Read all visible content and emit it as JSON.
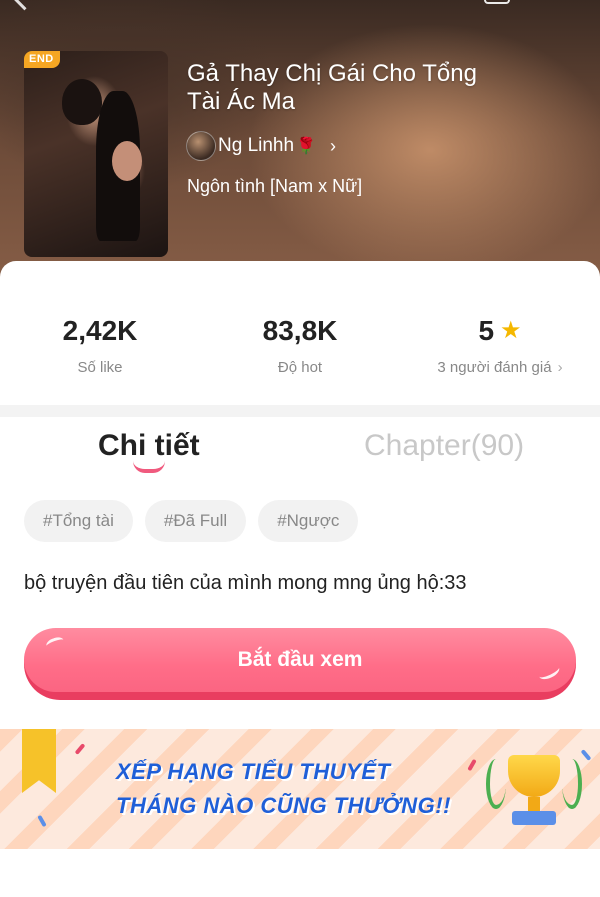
{
  "book": {
    "status_badge": "END",
    "title": "Gả Thay Chị Gái Cho Tổng Tài Ác Ma",
    "author": "Ng Linhh",
    "author_emoji": "🌹",
    "genre": "Ngôn tình [Nam x Nữ]"
  },
  "stats": [
    {
      "value": "2,42K",
      "label": "Số like"
    },
    {
      "value": "83,8K",
      "label": "Độ hot"
    },
    {
      "value": "5",
      "label": "3 người đánh giá"
    }
  ],
  "tabs": {
    "detail": "Chi tiết",
    "chapter": "Chapter(90)"
  },
  "tags": [
    "#Tổng tài",
    "#Đã Full",
    "#Ngược"
  ],
  "description": "bộ truyện đầu tiên của mình mong mng ủng hộ:33",
  "cta": {
    "label": "Bắt đầu xem"
  },
  "banner": {
    "line1": "XẾP HẠNG TIỂU THUYẾT",
    "line2": "THÁNG NÀO CŨNG THƯỞNG!!"
  },
  "colors": {
    "accent": "#f05a7e",
    "cta": "#ff6d88",
    "star": "#f5b800",
    "banner_text": "#1f5fd8"
  },
  "icons": {
    "rating": "star-icon",
    "author_more": "chevron-right-icon",
    "rating_more": "chevron-right-icon",
    "banner_prize": "trophy-icon"
  }
}
